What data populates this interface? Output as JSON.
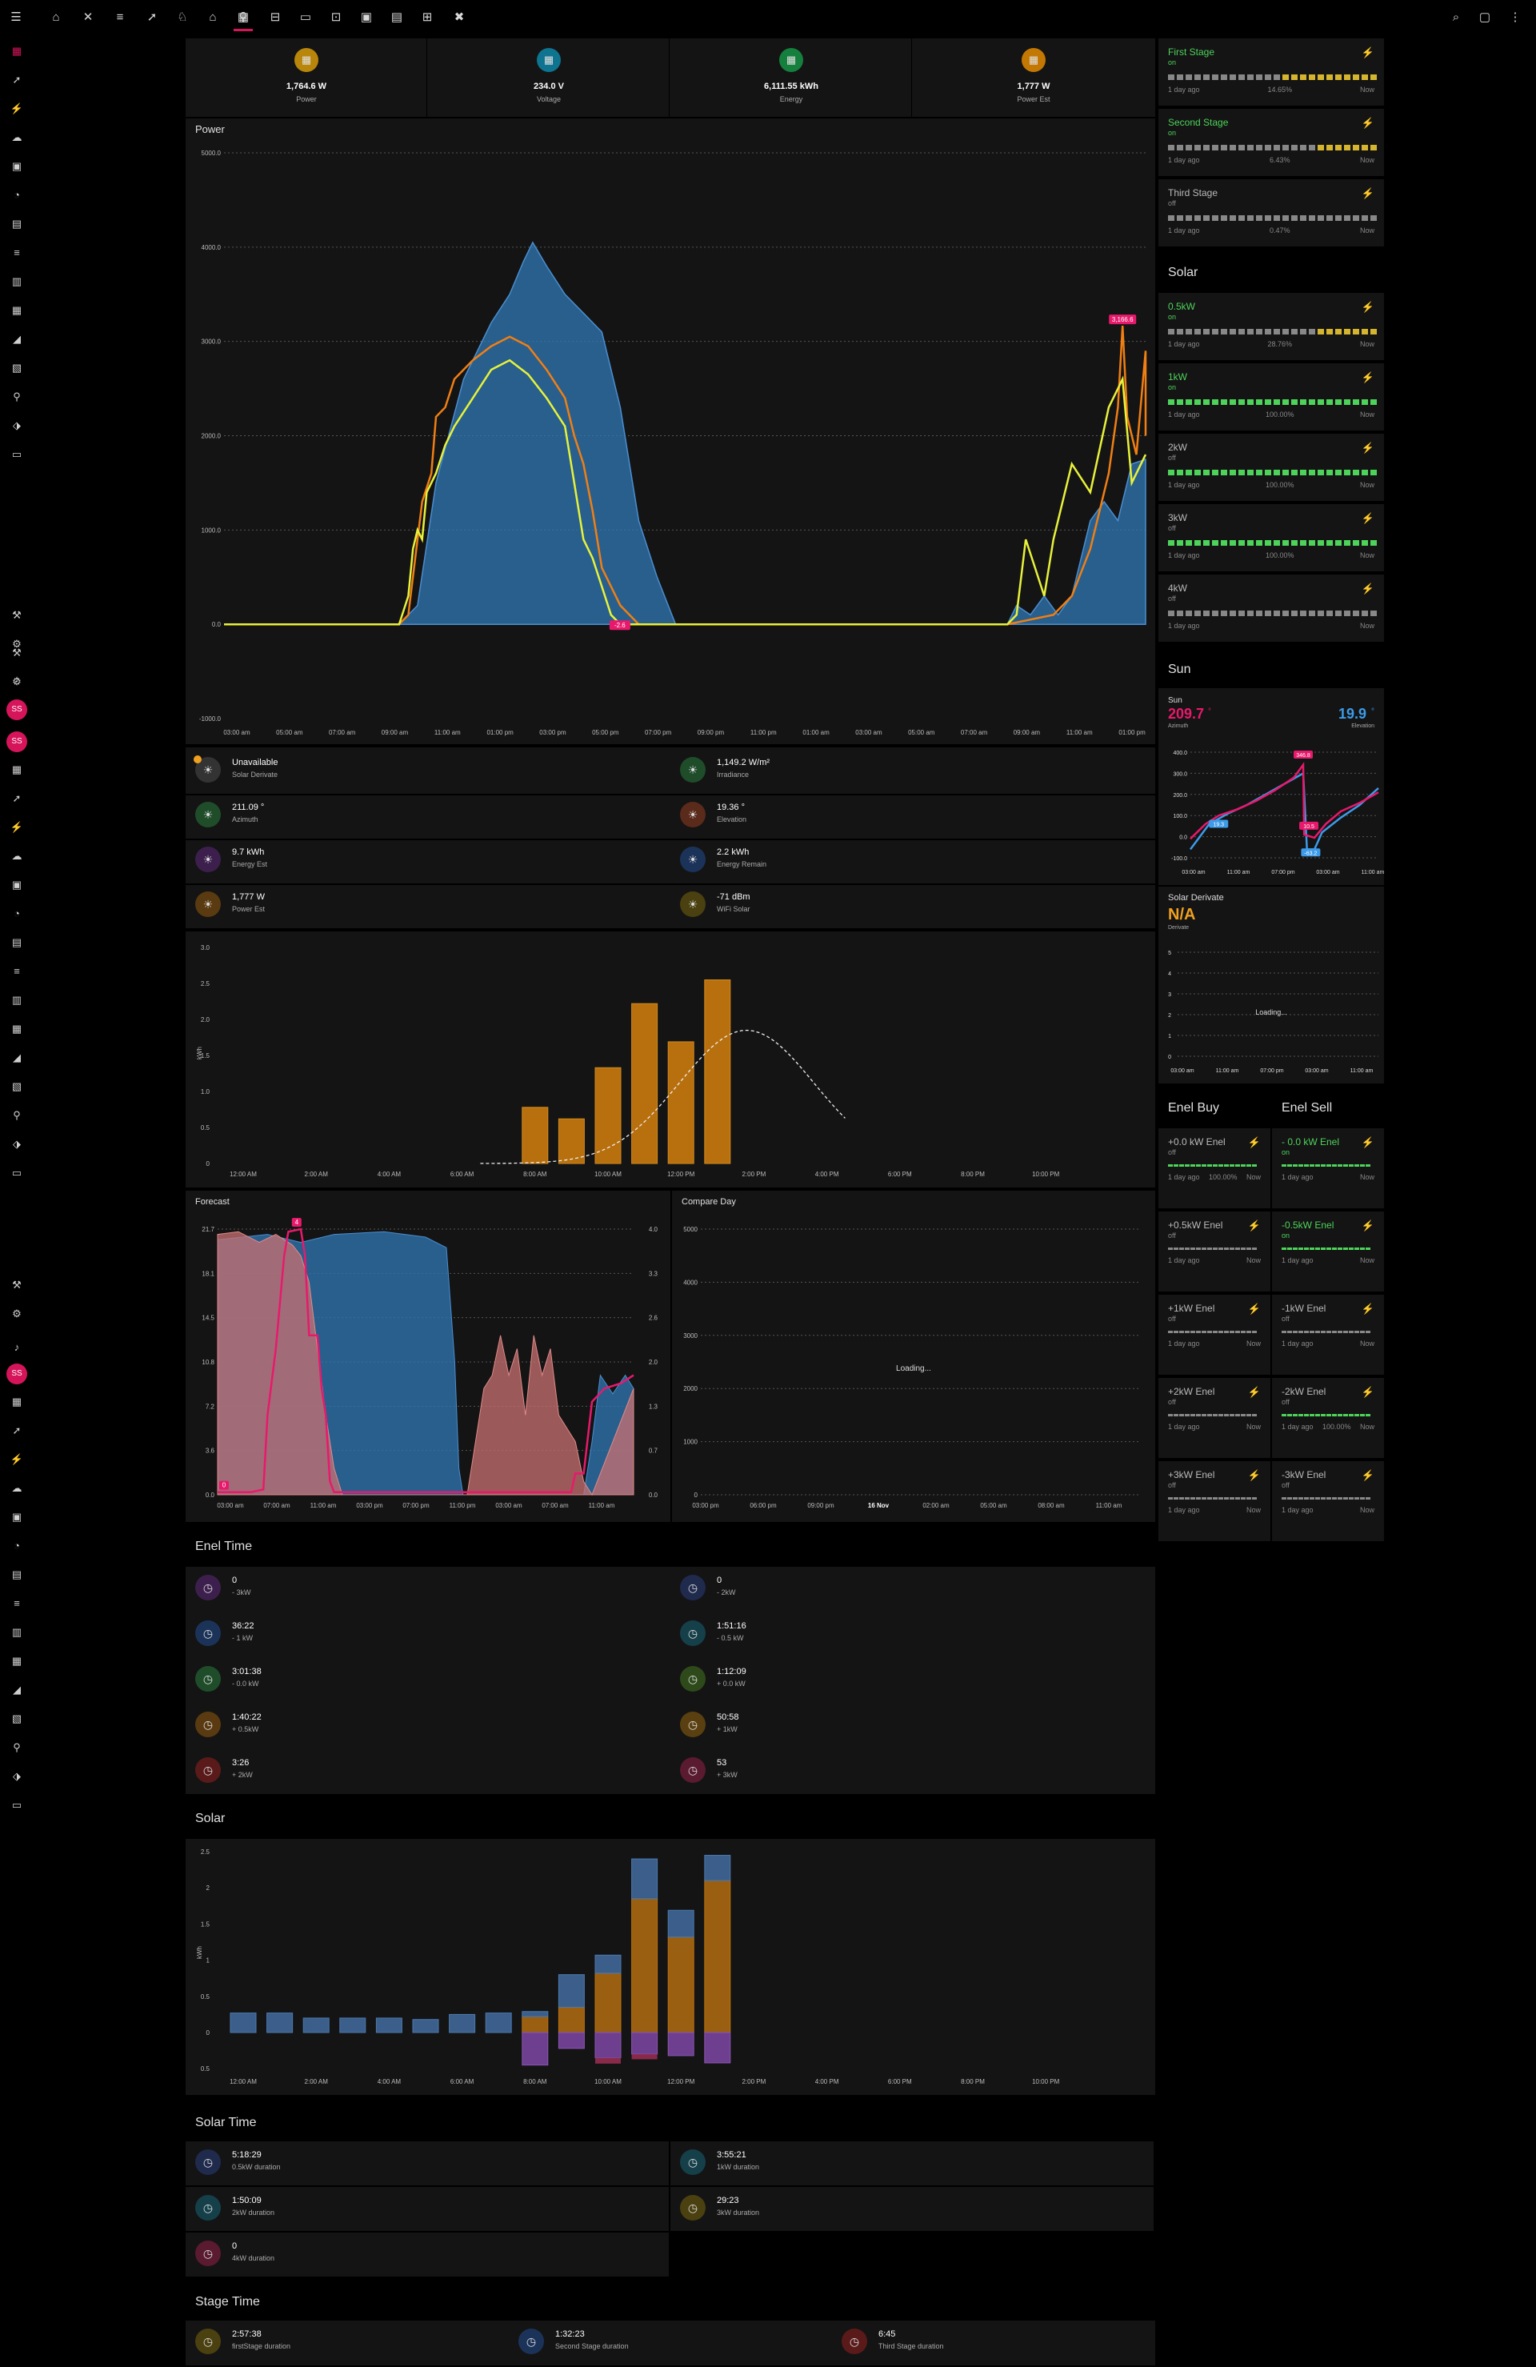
{
  "header_stats": [
    {
      "value": "1,764.6 W",
      "label": "Power",
      "icon": "solar-panel-icon",
      "color": "#b8860b"
    },
    {
      "value": "234.0 V",
      "label": "Voltage",
      "icon": "sine-wave-icon",
      "color": "#0e7490"
    },
    {
      "value": "6,111.55 kWh",
      "label": "Energy",
      "icon": "lightning-icon",
      "color": "#15803d"
    },
    {
      "value": "1,777 W",
      "label": "Power Est",
      "icon": "solar-panel-icon",
      "color": "#c27803"
    }
  ],
  "power_chart": {
    "title": "Power",
    "ylim": [
      -1000,
      5000
    ],
    "yticks": [
      "5000.0",
      "4000.0",
      "3000.0",
      "2000.0",
      "1000.0",
      "0.0",
      "-1000.0"
    ],
    "xticks": [
      "03:00 am",
      "05:00 am",
      "07:00 am",
      "09:00 am",
      "11:00 am",
      "01:00 pm",
      "03:00 pm",
      "05:00 pm",
      "07:00 pm",
      "09:00 pm",
      "11:00 pm",
      "01:00 am",
      "03:00 am",
      "05:00 am",
      "07:00 am",
      "09:00 am",
      "11:00 am",
      "01:00 pm"
    ],
    "marker_low": "-2.6",
    "marker_high": "3,166.6"
  },
  "chart_data": [
    {
      "type": "area",
      "title": "Power",
      "x": [
        "03:00 am",
        "05:00 am",
        "07:00 am",
        "09:00 am",
        "11:00 am",
        "01:00 pm",
        "03:00 pm",
        "05:00 pm",
        "07:00 pm",
        "09:00 pm",
        "11:00 pm",
        "01:00 am",
        "03:00 am",
        "05:00 am",
        "07:00 am",
        "09:00 am",
        "11:00 am",
        "01:00 pm"
      ],
      "series": [
        {
          "name": "",
          "color": "#2f78b5",
          "values": [
            0,
            0,
            0,
            1400,
            3800,
            3500,
            1400,
            0,
            0,
            0,
            0,
            0,
            0,
            0,
            0,
            600,
            1500,
            1800
          ]
        },
        {
          "name": "",
          "color": "#f07f14",
          "values": [
            0,
            0,
            0,
            1300,
            2900,
            2800,
            800,
            0,
            0,
            0,
            0,
            0,
            0,
            0,
            100,
            1000,
            3100,
            1900
          ]
        },
        {
          "name": "",
          "color": "#e8f23a",
          "values": [
            0,
            0,
            0,
            1100,
            2700,
            2500,
            500,
            0,
            0,
            0,
            0,
            0,
            0,
            0,
            0,
            800,
            2700,
            1800
          ]
        }
      ],
      "ylim": [
        -1000,
        5000
      ]
    },
    {
      "type": "bar",
      "title": "",
      "ylabel": "kWh",
      "categories": [
        "12:00 AM",
        "2:00 AM",
        "4:00 AM",
        "6:00 AM",
        "8:00 AM",
        "10:00 AM",
        "12:00 PM",
        "2:00 PM",
        "4:00 PM",
        "6:00 PM",
        "8:00 PM",
        "10:00 PM"
      ],
      "hourly_values": [
        0,
        0,
        0,
        0,
        0,
        0,
        0,
        0,
        0.78,
        0.62,
        1.33,
        2.22,
        1.69,
        2.55
      ],
      "ylim": [
        0,
        3.0
      ],
      "yticks": [
        "3.0",
        "2.5",
        "2.0",
        "1.5",
        "1.0",
        "0.5",
        "0"
      ]
    },
    {
      "type": "area",
      "title": "Forecast",
      "x": [
        "03:00 am",
        "07:00 am",
        "11:00 am",
        "03:00 pm",
        "07:00 pm",
        "11:00 pm",
        "03:00 am",
        "07:00 am",
        "11:00 am"
      ],
      "yticks_left": [
        "21.7",
        "18.1",
        "14.5",
        "10.8",
        "7.2",
        "3.6",
        "0.0"
      ],
      "yticks_right": [
        "4.0",
        "3.3",
        "2.6",
        "2.0",
        "1.3",
        "0.7",
        "0.0"
      ],
      "marker_top": "4",
      "marker_bottom": "0"
    },
    {
      "type": "line",
      "title": "Compare Day",
      "yticks": [
        "5000",
        "4000",
        "3000",
        "2000",
        "1000",
        "0"
      ],
      "x": [
        "03:00 pm",
        "06:00 pm",
        "09:00 pm",
        "16 Nov",
        "02:00 am",
        "05:00 am",
        "08:00 am",
        "11:00 am"
      ],
      "status": "Loading..."
    },
    {
      "type": "line",
      "title": "Sun",
      "yticks": [
        "400.0",
        "300.0",
        "200.0",
        "100.0",
        "0.0",
        "-100.0"
      ],
      "x": [
        "03:00 am",
        "11:00 am",
        "07:00 pm",
        "03:00 am",
        "11:00 am"
      ],
      "labels": [
        "346.8",
        "19.3",
        "10.5",
        "-63.2"
      ]
    },
    {
      "type": "line",
      "title": "Solar Derivate",
      "yticks": [
        "5",
        "4",
        "3",
        "2",
        "1",
        "0"
      ],
      "x": [
        "03:00 am",
        "11:00 am",
        "07:00 pm",
        "03:00 am",
        "11:00 am"
      ],
      "status": "Loading..."
    },
    {
      "type": "bar",
      "title": "Solar",
      "ylabel": "kWh",
      "categories": [
        "12:00 AM",
        "2:00 AM",
        "4:00 AM",
        "6:00 AM",
        "8:00 AM",
        "10:00 AM",
        "12:00 PM",
        "2:00 PM",
        "4:00 PM",
        "6:00 PM",
        "8:00 PM",
        "10:00 PM"
      ],
      "yticks": [
        "2.5",
        "2",
        "1.5",
        "1",
        "0.5",
        "0",
        "0.5"
      ]
    }
  ],
  "sensor_tiles": [
    {
      "value": "Unavailable",
      "label": "Solar Derivate",
      "color": "#333",
      "icon": "sun-icon"
    },
    {
      "value": "1,149.2 W/m²",
      "label": "Irradiance",
      "color": "#1f4d2a",
      "icon": "sun-icon"
    },
    {
      "value": "211.09 °",
      "label": "Azimuth",
      "color": "#1f4d2a",
      "icon": "compass-icon"
    },
    {
      "value": "19.36 °",
      "label": "Elevation",
      "color": "#5a2a1a",
      "icon": "angle-icon"
    },
    {
      "value": "9.7 kWh",
      "label": "Energy Est",
      "color": "#3d1f4d",
      "icon": "solar-panel-icon"
    },
    {
      "value": "2.2 kWh",
      "label": "Energy Remain",
      "color": "#1c3359",
      "icon": "solar-panel-icon"
    },
    {
      "value": "1,777 W",
      "label": "Power Est",
      "color": "#5a3a10",
      "icon": "solar-panel-icon"
    },
    {
      "value": "-71 dBm",
      "label": "WiFi Solar",
      "color": "#4a4010",
      "icon": "wifi-icon"
    }
  ],
  "enel_time": {
    "title": "Enel Time",
    "items": [
      {
        "value": "0",
        "label": "- 3kW",
        "color": "#3d1f4d"
      },
      {
        "value": "0",
        "label": "- 2kW",
        "color": "#1f2a4d"
      },
      {
        "value": "36:22",
        "label": "- 1 kW",
        "color": "#1c3359"
      },
      {
        "value": "1:51:16",
        "label": "- 0.5 kW",
        "color": "#15404a"
      },
      {
        "value": "3:01:38",
        "label": "- 0.0 kW",
        "color": "#1f4d2a"
      },
      {
        "value": "1:12:09",
        "label": "+ 0.0 kW",
        "color": "#2e4a1a"
      },
      {
        "value": "1:40:22",
        "label": "+ 0.5kW",
        "color": "#5a3a10"
      },
      {
        "value": "50:58",
        "label": "+ 1kW",
        "color": "#5a4010"
      },
      {
        "value": "3:26",
        "label": "+ 2kW",
        "color": "#5a1a1a"
      },
      {
        "value": "53",
        "label": "+ 3kW",
        "color": "#5a1a30"
      }
    ]
  },
  "solar_time": {
    "title": "Solar Time",
    "items": [
      {
        "value": "5:18:29",
        "label": "0.5kW duration",
        "color": "#1f2a4d"
      },
      {
        "value": "3:55:21",
        "label": "1kW duration",
        "color": "#15404a"
      },
      {
        "value": "1:50:09",
        "label": "2kW duration",
        "color": "#15404a"
      },
      {
        "value": "29:23",
        "label": "3kW duration",
        "color": "#4a4010"
      },
      {
        "value": "0",
        "label": "4kW duration",
        "color": "#5a1a30"
      }
    ]
  },
  "stage_time": {
    "title": "Stage Time",
    "items": [
      {
        "value": "2:57:38",
        "label": "firstStage duration",
        "color": "#4a4010"
      },
      {
        "value": "1:32:23",
        "label": "Second Stage duration",
        "color": "#1c3359"
      },
      {
        "value": "6:45",
        "label": "Third Stage duration",
        "color": "#5a1a1a"
      }
    ]
  },
  "stages": [
    {
      "name": "First Stage",
      "state": "on",
      "percent": "14.65%",
      "from": "1 day ago",
      "to": "Now"
    },
    {
      "name": "Second Stage",
      "state": "on",
      "percent": "6.43%",
      "from": "1 day ago",
      "to": "Now"
    },
    {
      "name": "Third Stage",
      "state": "off",
      "percent": "0.47%",
      "from": "1 day ago",
      "to": "Now"
    }
  ],
  "solar_switches": {
    "title": "Solar",
    "items": [
      {
        "name": "0.5kW",
        "state": "on",
        "percent": "28.76%",
        "from": "1 day ago",
        "to": "Now"
      },
      {
        "name": "1kW",
        "state": "on",
        "percent": "100.00%",
        "from": "1 day ago",
        "to": "Now"
      },
      {
        "name": "2kW",
        "state": "off",
        "percent": "100.00%",
        "from": "1 day ago",
        "to": "Now"
      },
      {
        "name": "3kW",
        "state": "off",
        "percent": "100.00%",
        "from": "1 day ago",
        "to": "Now"
      },
      {
        "name": "4kW",
        "state": "off",
        "percent": "",
        "from": "1 day ago",
        "to": "Now"
      }
    ]
  },
  "sun": {
    "title": "Sun",
    "name": "Sun",
    "azimuth": "209.7",
    "azimuth_label": "Azimuth",
    "elevation": "19.9",
    "elevation_label": "Elevation",
    "unit": "°"
  },
  "solar_derivate": {
    "name": "Solar Derivate",
    "value": "N/A",
    "label": "Derivate",
    "status": "Loading..."
  },
  "enel_buy": {
    "title": "Enel Buy",
    "items": [
      {
        "name": "+0.0 kW Enel",
        "state": "off",
        "percent": "100.00%",
        "from": "1 day ago",
        "to": "Now"
      },
      {
        "name": "+0.5kW Enel",
        "state": "off",
        "percent": "",
        "from": "1 day ago",
        "to": "Now"
      },
      {
        "name": "+1kW Enel",
        "state": "off",
        "percent": "",
        "from": "1 day ago",
        "to": "Now"
      },
      {
        "name": "+2kW Enel",
        "state": "off",
        "percent": "",
        "from": "1 day ago",
        "to": "Now"
      },
      {
        "name": "+3kW Enel",
        "state": "off",
        "percent": "",
        "from": "1 day ago",
        "to": "Now"
      }
    ]
  },
  "enel_sell": {
    "title": "Enel Sell",
    "items": [
      {
        "name": "- 0.0 kW Enel",
        "state": "on",
        "percent": "",
        "from": "1 day ago",
        "to": "Now"
      },
      {
        "name": "-0.5kW Enel",
        "state": "on",
        "percent": "",
        "from": "1 day ago",
        "to": "Now"
      },
      {
        "name": "-1kW Enel",
        "state": "off",
        "percent": "",
        "from": "1 day ago",
        "to": "Now"
      },
      {
        "name": "-2kW Enel",
        "state": "off",
        "percent": "100.00%",
        "from": "1 day ago",
        "to": "Now"
      },
      {
        "name": "-3kW Enel",
        "state": "off",
        "percent": "",
        "from": "1 day ago",
        "to": "Now"
      }
    ]
  },
  "colors": {
    "accent": "#d6145a",
    "on": "#4ed35a",
    "blue": "#2f78b5",
    "orange": "#f07f14",
    "yellow": "#e8f23a",
    "pink": "#e8196c",
    "bar_orange": "#b8700f",
    "bar_blue": "#3b5f8a",
    "bar_purple": "#6e3f8f"
  }
}
